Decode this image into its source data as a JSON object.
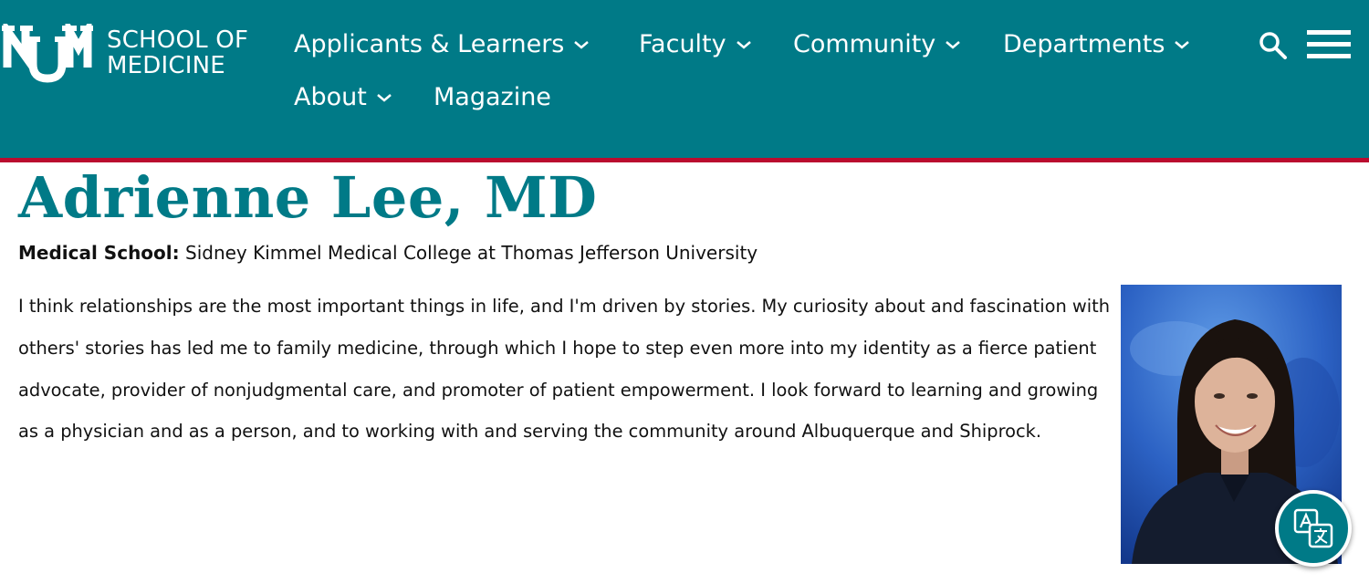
{
  "header": {
    "logo_line1": "SCHOOL OF",
    "logo_line2": "MEDICINE",
    "logo_mark_icon": "unm-logo-icon",
    "brand_color": "#007a87",
    "rule_color": "#ba0c2f",
    "nav": [
      {
        "label": "Applicants & Learners",
        "has_dropdown": true
      },
      {
        "label": "Faculty",
        "has_dropdown": true
      },
      {
        "label": "Community",
        "has_dropdown": true
      },
      {
        "label": "Departments",
        "has_dropdown": true
      },
      {
        "label": "About",
        "has_dropdown": true
      },
      {
        "label": "Magazine",
        "has_dropdown": false
      }
    ],
    "search_icon": "search-icon",
    "menu_icon": "hamburger-menu-icon"
  },
  "profile": {
    "name": "Adrienne Lee, MD",
    "medical_school_label": "Medical School:",
    "medical_school_value": " Sidney Kimmel Medical College at Thomas Jefferson University",
    "bio": " I think relationships are the most important things in life, and I'm driven by stories. My curiosity about and fascination with others' stories has led me to family medicine, through which I hope to step even more into my identity as a fierce patient advocate, provider of nonjudgmental care, and promoter of patient empowerment. I look forward to learning and growing as a physician and as a person, and to working with and serving the community around Albuquerque and Shiprock."
  },
  "widgets": {
    "translate_icon": "translate-icon"
  }
}
